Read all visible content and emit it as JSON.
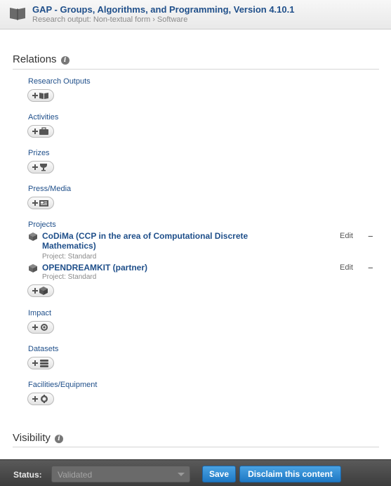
{
  "header": {
    "title": "GAP - Groups, Algorithms, and Programming, Version 4.10.1",
    "subtitle": "Research output: Non-textual form › Software",
    "icon": "open-book-icon"
  },
  "relations": {
    "title": "Relations",
    "info_icon": "i",
    "groups": {
      "research_outputs": {
        "label": "Research Outputs",
        "icon": "book-icon"
      },
      "activities": {
        "label": "Activities",
        "icon": "briefcase-icon"
      },
      "prizes": {
        "label": "Prizes",
        "icon": "trophy-icon"
      },
      "press_media": {
        "label": "Press/Media",
        "icon": "newspaper-icon"
      },
      "projects": {
        "label": "Projects",
        "icon": "cube-icon"
      },
      "impact": {
        "label": "Impact",
        "icon": "target-icon"
      },
      "datasets": {
        "label": "Datasets",
        "icon": "database-icon"
      },
      "facilities": {
        "label": "Facilities/Equipment",
        "icon": "gear-icon"
      }
    },
    "projects": [
      {
        "name": "CoDiMa (CCP in the area of Computational Discrete Mathematics)",
        "type": "Project: Standard",
        "edit": "Edit",
        "remove": "−"
      },
      {
        "name": "OPENDREAMKIT (partner)",
        "type": "Project: Standard",
        "edit": "Edit",
        "remove": "−"
      }
    ]
  },
  "visibility": {
    "title": "Visibility",
    "info_icon": "i"
  },
  "footer": {
    "status_label": "Status:",
    "status_value": "Validated",
    "save_label": "Save",
    "disclaim_label": "Disclaim this content"
  }
}
